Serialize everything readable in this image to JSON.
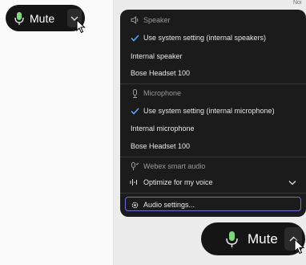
{
  "mute_control_top": {
    "label": "Mute",
    "icon": "microphone-icon",
    "chevron": "chevron-down-icon"
  },
  "mute_control_bottom": {
    "label": "Mute",
    "icon": "microphone-icon",
    "chevron": "chevron-up-icon"
  },
  "background_label": "Noi",
  "audio_menu": {
    "speaker_header": "Speaker",
    "speaker_options": [
      {
        "label": "Use system setting (internal speakers)",
        "selected": true
      },
      {
        "label": "Internal speaker",
        "selected": false
      },
      {
        "label": "Bose Headset 100",
        "selected": false
      }
    ],
    "microphone_header": "Microphone",
    "microphone_options": [
      {
        "label": "Use system setting (internal microphone)",
        "selected": true
      },
      {
        "label": "Internal microphone",
        "selected": false
      },
      {
        "label": "Bose Headset 100",
        "selected": false
      }
    ],
    "smart_audio_header": "Webex smart audio",
    "smart_audio_value": "Optimize for my voice",
    "settings_label": "Audio settings..."
  },
  "colors": {
    "menu_bg": "#1b1b1b",
    "pill_bg": "#151515",
    "focus_ring": "#6b6bd9",
    "header_text": "#9a9a9a"
  }
}
